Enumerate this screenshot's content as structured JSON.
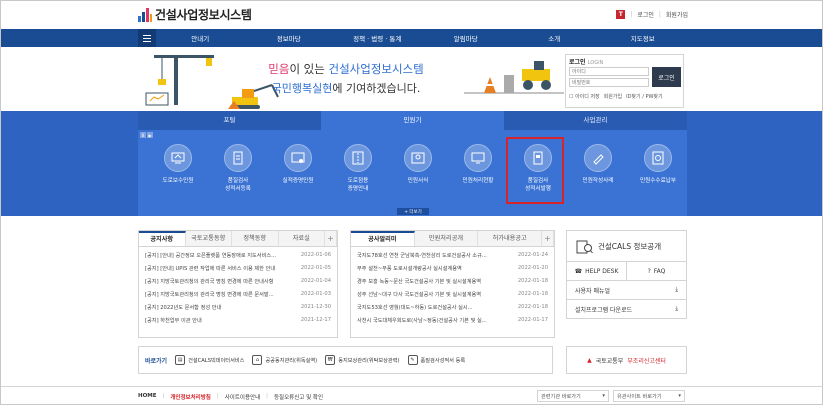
{
  "header": {
    "site_title": "건설사업정보시스템",
    "util_badge": "T",
    "login_link": "로그인",
    "join_link": "회원가입"
  },
  "nav": {
    "items": [
      "안내기",
      "정보마당",
      "정책 · 법령 · 통계",
      "알림마당",
      "소개",
      "지도정보"
    ]
  },
  "banner": {
    "line1_a": "믿음",
    "line1_b": "이 있는 ",
    "line1_c": "건설사업정보시스템",
    "line2_a": "국민행복실현",
    "line2_b": "에 기여하겠습니다."
  },
  "login": {
    "title": "로그인",
    "title_en": "LOGIN",
    "id_placeholder": "아이디",
    "pw_placeholder": "비밀번호",
    "button": "로그인",
    "save_id": "아이디 저장",
    "join": "회원가입",
    "find": "ID찾기 / PW찾기"
  },
  "quick": {
    "tabs": [
      "포털",
      "민원기",
      "사업관리"
    ],
    "pause_icons": [
      "II",
      "▶"
    ],
    "items": [
      {
        "label": "도로보수민원"
      },
      {
        "label": "품질검사\n성적서등록"
      },
      {
        "label": "실적증명민원"
      },
      {
        "label": "도로점용\n증명안내"
      },
      {
        "label": "민원서식"
      },
      {
        "label": "민원처리현황"
      },
      {
        "label": "품질검사\n성적서발행"
      },
      {
        "label": "민원작성사례"
      },
      {
        "label": "민원수수료납부"
      }
    ],
    "more": "+ 더보기"
  },
  "notice": {
    "tabs": [
      "공지사항",
      "국토교통동향",
      "정책동향",
      "자료실"
    ],
    "plus": "+",
    "rows": [
      {
        "title": "[공지] [안내] 공간정보 오픈플랫폼 연동장애로 지도서비스...",
        "date": "2022-01-06"
      },
      {
        "title": "[공지] [안내] UPIS 관련 작업에 따른 서비스 이용 제한 안내",
        "date": "2022-01-05"
      },
      {
        "title": "[공지] 지방국토관리청의 관리국 명칭 변경에 따른 안내사항",
        "date": "2022-01-04"
      },
      {
        "title": "[공지] 지방국토관리청의 관리국 명칭 변경에 따른 문서발...",
        "date": "2022-01-03"
      },
      {
        "title": "[공지] 2022년도 문서함 정성 안내",
        "date": "2021-12-30"
      },
      {
        "title": "[공지] 하천업무 이관 안내",
        "date": "2021-12-17"
      }
    ]
  },
  "construction": {
    "tabs": [
      "공사알리미",
      "민원처리공개",
      "허가내용공고"
    ],
    "plus": "+",
    "rows": [
      {
        "title": "국지도78호선 연천 군남북측-연천삼리 도로건설공사 소규...",
        "date": "2022-01-24"
      },
      {
        "title": "무주 설천~무풍 도로시설개량공사 실시설계용역",
        "date": "2022-01-20"
      },
      {
        "title": "경주 보홍 녹동~문산 국도건설공사 기본 및 실시설계용역",
        "date": "2022-01-18"
      },
      {
        "title": "성주 선남~대구 다사 국도건설공사 기본 및 실시설계용역",
        "date": "2022-01-18"
      },
      {
        "title": "국지도53호선 영월(대도~하동) 도로건설공사 실시...",
        "date": "2022-01-18"
      },
      {
        "title": "사천시 국도대체우회도로(사남~정동)건설공사 기본 및 실...",
        "date": "2022-01-17"
      }
    ]
  },
  "side": {
    "cals_brand": "건설CALS",
    "cals_suffix": " 정보공개",
    "helpdesk": "HELP DESK",
    "faq": "FAQ",
    "manual": "사용자 매뉴얼",
    "install": "설치프로그램 다운로드"
  },
  "links": {
    "label": "바로가기",
    "items": [
      "건설CALS빅데이터서비스",
      "공공동지관리(위독실역)",
      "동지보상관리(위탁보상관력)",
      "품질검사성적서 등록"
    ]
  },
  "report": {
    "a": "국토교통부",
    "b": "부조리신고센터"
  },
  "footer": {
    "home": "HOME",
    "privacy": "개인정보처리방침",
    "guide": "사이트이용안내",
    "email": "등질오류신고 및 확인",
    "related1": "관련기관 바로가기",
    "related2": "유관사이트 바로가기"
  },
  "colors": {
    "nav": "#1a4c93",
    "quick": "#3a73d4",
    "highlight": "#d8232a"
  }
}
